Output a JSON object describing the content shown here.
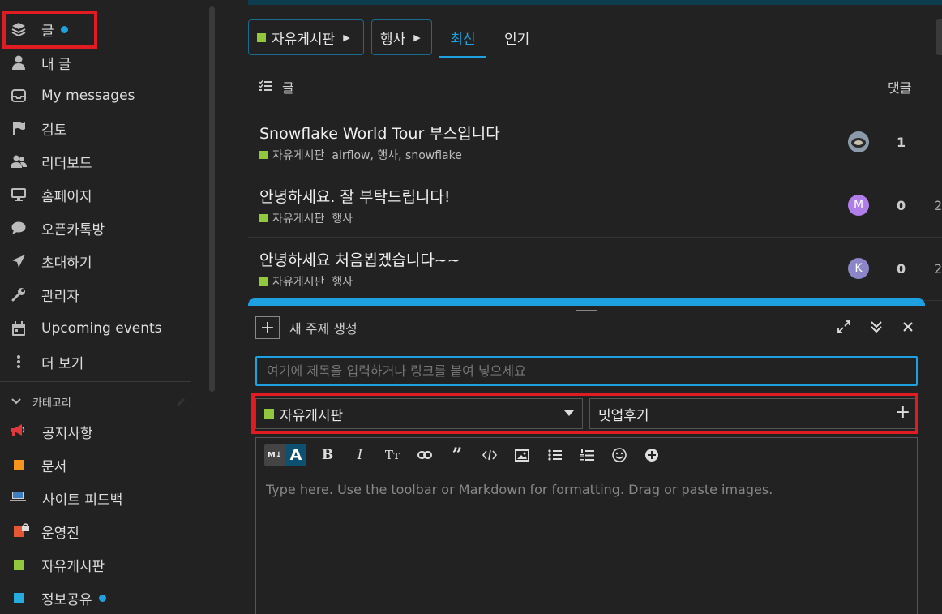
{
  "sidebar": {
    "items": [
      {
        "label": "글",
        "icon": "layers-icon"
      },
      {
        "label": "내 글",
        "icon": "user-icon"
      },
      {
        "label": "My messages",
        "icon": "inbox-icon"
      },
      {
        "label": "검토",
        "icon": "flag-icon"
      },
      {
        "label": "리더보드",
        "icon": "users-icon"
      },
      {
        "label": "홈페이지",
        "icon": "desktop-icon"
      },
      {
        "label": "오픈카톡방",
        "icon": "chat-icon"
      },
      {
        "label": "초대하기",
        "icon": "paper-plane-icon"
      },
      {
        "label": "관리자",
        "icon": "wrench-icon"
      },
      {
        "label": "Upcoming events",
        "icon": "calendar-icon"
      },
      {
        "label": "더 보기",
        "icon": "vertical-dots-icon"
      }
    ],
    "categories_header": "카테고리",
    "categories": [
      {
        "label": "공지사항",
        "color": "#e2373b"
      },
      {
        "label": "문서",
        "color": "#f7941d"
      },
      {
        "label": "사이트 피드백",
        "color": "#3d7fc1"
      },
      {
        "label": "운영진",
        "color": "#e45735"
      },
      {
        "label": "자유게시판",
        "color": "#92c83e"
      },
      {
        "label": "정보공유",
        "color": "#25aae2"
      }
    ]
  },
  "nav": {
    "category": "자유게시판",
    "tag": "행사",
    "tab_latest": "최신",
    "tab_top": "인기"
  },
  "list": {
    "header_topic": "글",
    "header_replies": "댓글",
    "topics": [
      {
        "title": "Snowflake World Tour 부스입니다",
        "category": "자유게시판",
        "tags": "airflow, 행사, snowflake",
        "replies": "1",
        "avatar_letter": "",
        "date": ""
      },
      {
        "title": "안녕하세요. 잘 부탁드립니다!",
        "category": "자유게시판",
        "tags": "행사",
        "replies": "0",
        "avatar_letter": "M",
        "date": "2"
      },
      {
        "title": "안녕하세요 처음뵙겠습니다~~",
        "category": "자유게시판",
        "tags": "행사",
        "replies": "0",
        "avatar_letter": "K",
        "date": "2"
      }
    ]
  },
  "composer": {
    "heading": "새 주제 생성",
    "title_placeholder": "여기에 제목을 입력하거나 링크를 붙여 넣으세요",
    "category": "자유게시판",
    "tag": "밋업후기",
    "editor_placeholder": "Type here. Use the toolbar or Markdown for formatting. Drag or paste images.",
    "toolbar_md_label": "M↓"
  },
  "colors": {
    "accent": "#1ea1e0",
    "highlight_box": "#e11b22",
    "category_free": "#92c83e",
    "background": "#222222"
  }
}
